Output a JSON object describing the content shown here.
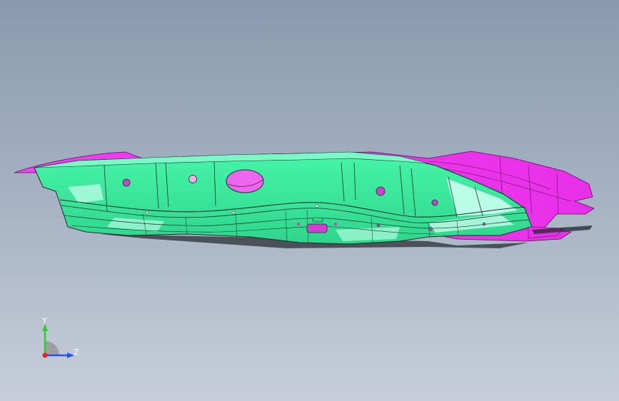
{
  "viewport": {
    "colors": {
      "bg_top": "#8a9aae",
      "bg_bottom": "#c7ced9"
    }
  },
  "model": {
    "colors": {
      "part_green": "#3ef0a0",
      "part_green_light": "#c9fff0",
      "part_magenta": "#ee33ee",
      "edge": "#1a2a22"
    }
  },
  "triad": {
    "y_label": "Y",
    "z_label": "Z",
    "colors": {
      "y_axis": "#33cc33",
      "z_axis": "#2255ee",
      "x_axis": "#ee2222",
      "plane": "#9a9a9a"
    }
  }
}
